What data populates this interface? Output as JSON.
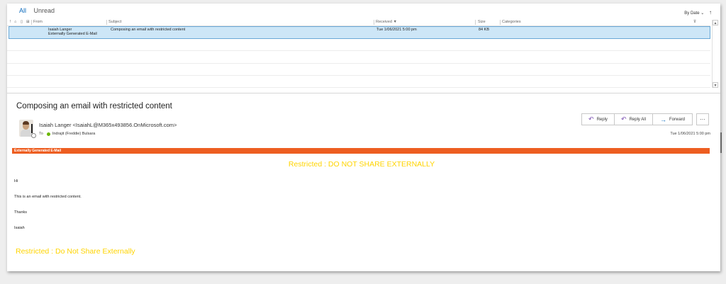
{
  "filter_tabs": {
    "all": "All",
    "unread": "Unread"
  },
  "sort": {
    "label": "By Date",
    "caret": "⌄",
    "arrow": "↑"
  },
  "list": {
    "columns": {
      "from": "From",
      "subject": "Subject",
      "received": "Received",
      "size": "Size",
      "categories": "Categories"
    },
    "header_icons": [
      "!",
      "⌂",
      "▯",
      "⊞"
    ],
    "sort_indicator": "▼",
    "rows": [
      {
        "from": "Isaiah Langer",
        "from_sub": "Externally Generated E-Mail",
        "subject": "Composing an email with restricted content",
        "received": "Tue 1/06/2021 5:00 pm",
        "size": "84 KB",
        "categories": ""
      }
    ]
  },
  "message": {
    "subject": "Composing an email with restricted content",
    "sender": "Isaiah Langer <IsaiahL@M365x493856.OnMicrosoft.com>",
    "to_label": "To",
    "to_name": "Indrajit (Freddie) Bulsara",
    "received": "Tue 1/06/2021 5:00 pm",
    "actions": {
      "reply": "Reply",
      "reply_all": "Reply All",
      "forward": "Forward",
      "more": "···"
    },
    "banner": "Externally Generated E-Mail",
    "restricted_top": "Restricted : DO NOT SHARE EXTERNALLY",
    "body": [
      "Hi",
      "This is an email with restricted content.",
      "Thanks",
      "Isaiah"
    ],
    "restricted_bottom": "Restricted : Do Not Share Externally"
  },
  "colors": {
    "accent": "#0f6cbd",
    "banner": "#ed5e21",
    "restricted": "#ffd400",
    "selected_row": "#cde6f7",
    "presence": "#6bb700"
  }
}
